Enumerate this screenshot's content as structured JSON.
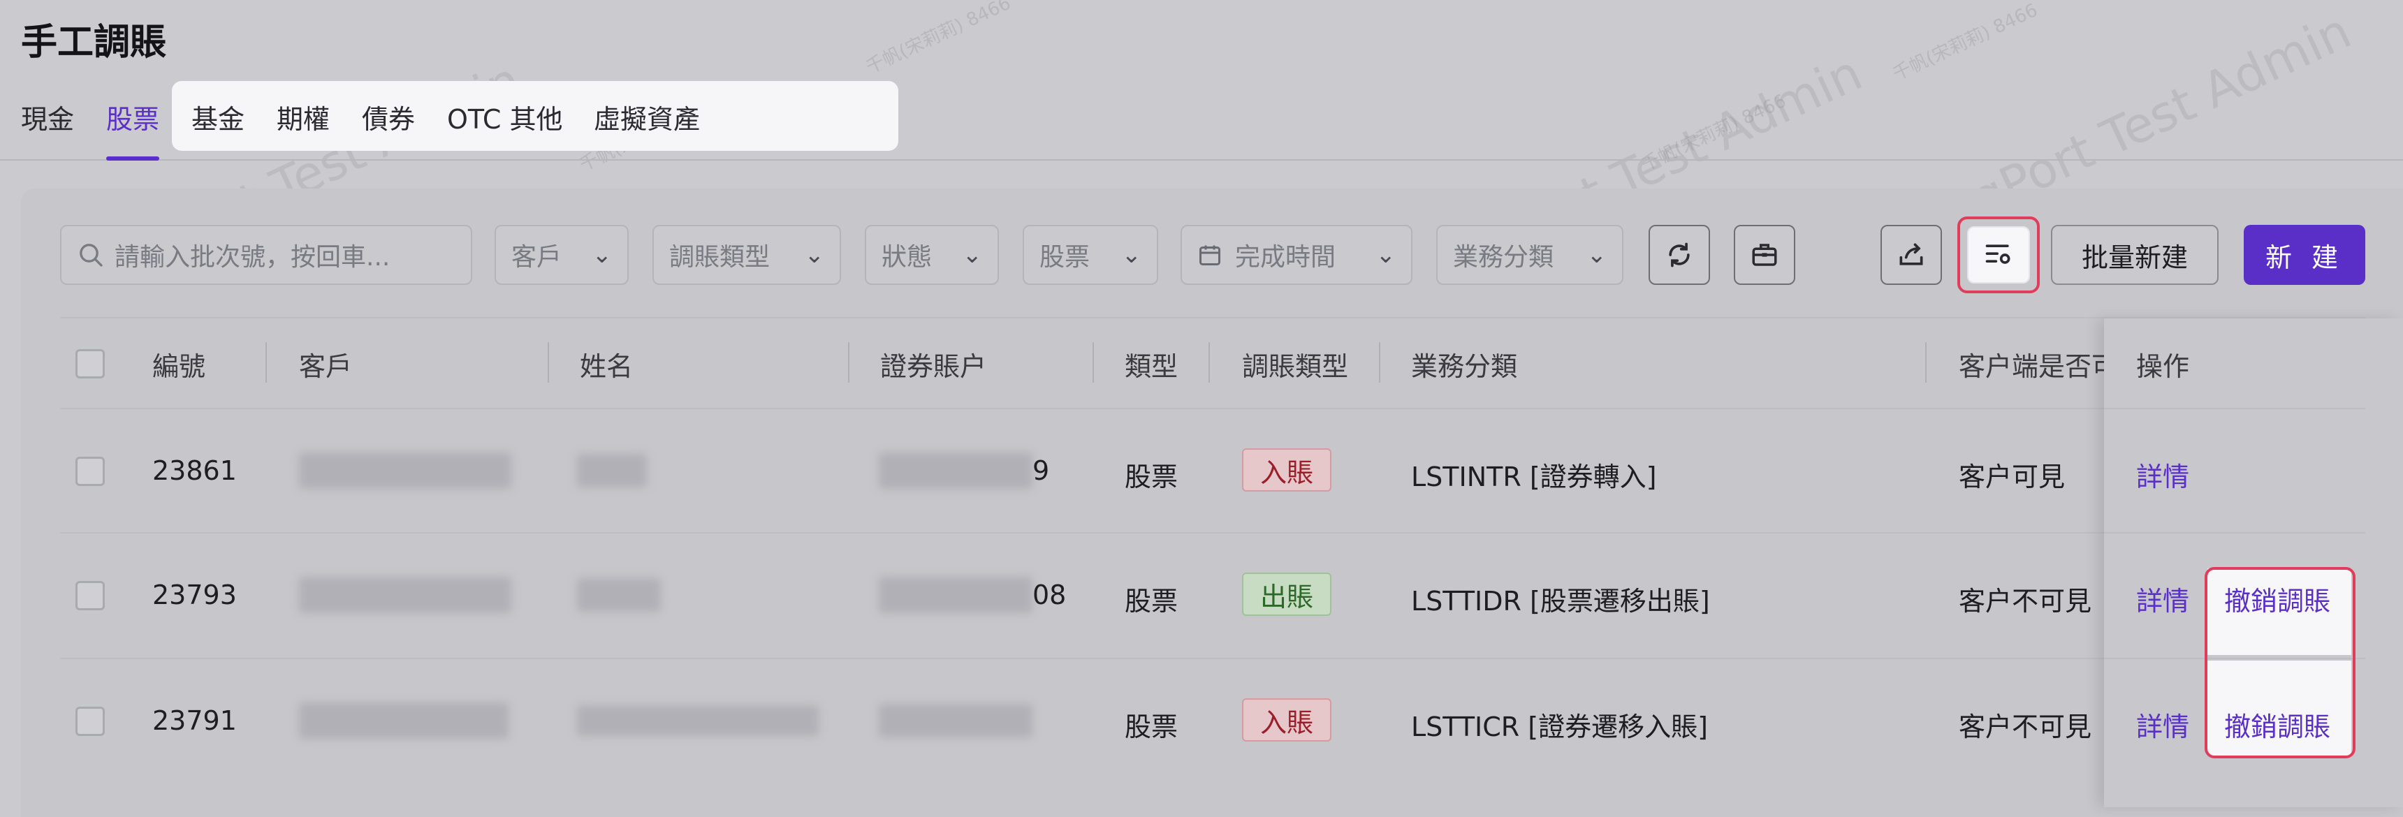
{
  "page": {
    "title": "手工調賬"
  },
  "tabs": [
    {
      "label": "現金",
      "active": false
    },
    {
      "label": "股票",
      "active": true
    },
    {
      "label": "基金",
      "active": false
    },
    {
      "label": "期權",
      "active": false
    },
    {
      "label": "債券",
      "active": false
    },
    {
      "label": "OTC 其他",
      "active": false
    },
    {
      "label": "虛擬資產",
      "active": false
    }
  ],
  "watermark": {
    "large": "LongPort Test Admin",
    "small": "千帆(宋莉莉) 8466"
  },
  "filters": {
    "search_placeholder": "請輸入批次號，按回車...",
    "client": "客戶",
    "adjust_type": "調賬類型",
    "status": "狀態",
    "stock": "股票",
    "complete_time": "完成時間",
    "business_category": "業務分類"
  },
  "toolbar": {
    "refresh_icon": "refresh-icon",
    "toolbox_icon": "toolbox-icon",
    "export_icon": "export-icon",
    "column_settings_icon": "column-settings-icon",
    "batch_new": "批量新建",
    "new": "新 建"
  },
  "table": {
    "columns": [
      "編號",
      "客戶",
      "姓名",
      "證券賬户",
      "類型",
      "調賬類型",
      "業務分類",
      "客户端是否可",
      "操作"
    ],
    "rows": [
      {
        "id": "23861",
        "account_suffix": "9",
        "type": "股票",
        "adjust": "入賬",
        "adjust_kind": "in",
        "category": "LSTINTR [證券轉入]",
        "visibility": "客户可見",
        "actions": [
          "詳情"
        ]
      },
      {
        "id": "23793",
        "account_suffix": "08",
        "type": "股票",
        "adjust": "出賬",
        "adjust_kind": "out",
        "category": "LSTTIDR [股票遷移出賬]",
        "visibility": "客户不可見",
        "actions": [
          "詳情",
          "撤銷調賬"
        ]
      },
      {
        "id": "23791",
        "account_suffix": "",
        "type": "股票",
        "adjust": "入賬",
        "adjust_kind": "in",
        "category": "LSTTICR [證券遷移入賬]",
        "visibility": "客户不可見",
        "actions": [
          "詳情",
          "撤銷調賬"
        ]
      }
    ]
  },
  "colors": {
    "accent": "#5a2fc7",
    "highlight_border": "#e03c5c"
  }
}
